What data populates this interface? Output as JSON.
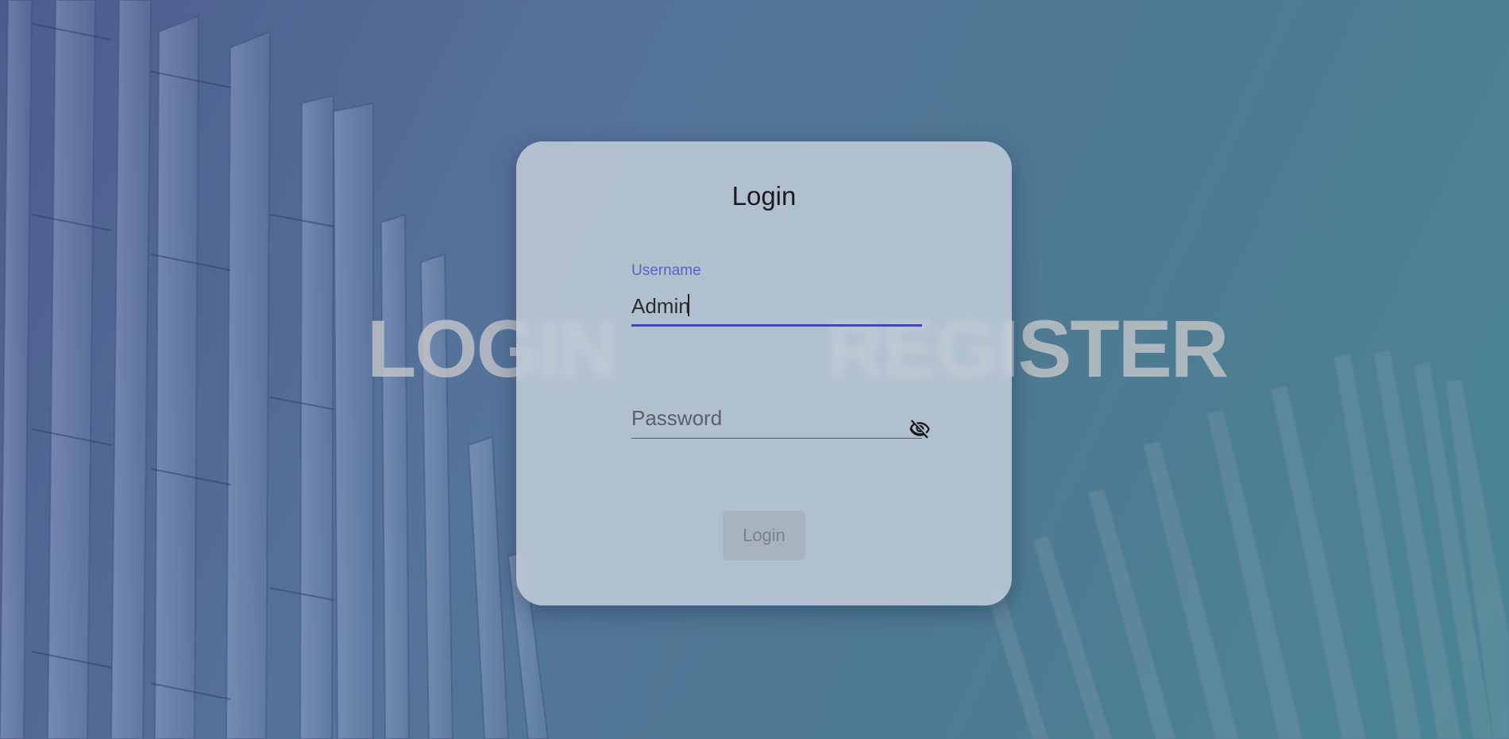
{
  "background": {
    "tabs": {
      "login_label": "LOGIN",
      "register_label": "REGISTER"
    }
  },
  "login_card": {
    "title": "Login",
    "username": {
      "label": "Username",
      "value": "Admin"
    },
    "password": {
      "placeholder": "Password",
      "visibility_icon": "eye-off-icon"
    },
    "submit_label": "Login"
  },
  "colors": {
    "accent": "#3f4ab8",
    "label_accent": "#5a63c4"
  }
}
